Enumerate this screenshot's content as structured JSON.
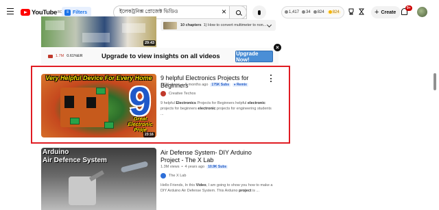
{
  "header": {
    "logo_text": "YouTube",
    "logo_country": "BD",
    "filters_label": "Filters",
    "search_query": "ইলেকট্রনিক্স প্রোজেক্ট ভিডিও",
    "stats": [
      "1,417",
      "34",
      "824",
      "824"
    ],
    "create_label": "Create",
    "notification_count": "9+",
    "colors": {
      "brand": "#ff0000",
      "accent": "#1a73e8"
    },
    "icons": [
      "menu-icon",
      "search-icon",
      "clear-icon",
      "mic-icon",
      "bell-icon",
      "plus-icon"
    ]
  },
  "previous_result": {
    "duration": "29:43",
    "chapters_count": "10 chapters",
    "chapters_text": "1) How to convert multimeter to non..."
  },
  "upgrade_banner": {
    "views_stat": "1.7M",
    "likes_stat": "0.61%",
    "likes_suffix": "ER",
    "text": "Upgrade to view insights on all videos",
    "button_label": "Upgrade Now!",
    "close_glyph": "×"
  },
  "results": [
    {
      "thumb_title": "Very Helpful Device For Every Home",
      "thumb_number": "9",
      "thumb_caption": "Great Electronic Proje",
      "duration": "23:16",
      "title": "9 helpful Electronics Projects for Beginners",
      "views": "182K views",
      "age": "5 months ago",
      "subs_badge": "175K Subs",
      "remix_badge": "Remix",
      "channel": "Creative Techos",
      "desc_parts": [
        "9 helpful ",
        "Electronics",
        " Projects for Beginners helpful ",
        "electronic",
        " projects for beginners ",
        "electronic",
        " projects for engineering students ..."
      ]
    },
    {
      "thumb_title_line1": "Arduino",
      "thumb_title_line2": "Air Defence System",
      "title": "Air Defense System- DIY Arduino Project - The X Lab",
      "views": "1.3M views",
      "age": "4 years ago",
      "subs_badge": "10.9K Subs",
      "channel": "The X Lab",
      "desc_parts": [
        "Hello Friends, In this ",
        "Video",
        ", I am going to show you how to make a DIY Arduino Air Defense System. This Arduino ",
        "project",
        " is ..."
      ]
    }
  ]
}
